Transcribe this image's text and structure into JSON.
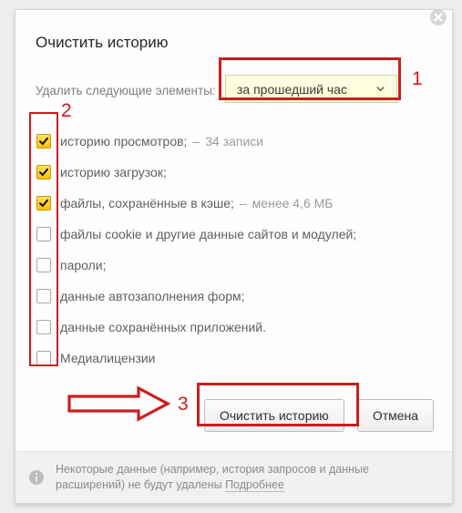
{
  "title": "Очистить историю",
  "time_range": {
    "label": "Удалить следующие элементы:",
    "selected": "за прошедший час"
  },
  "options": [
    {
      "label": "историю просмотров;",
      "checked": true,
      "hint": "34 записи"
    },
    {
      "label": "историю загрузок;",
      "checked": true
    },
    {
      "label": "файлы, сохранённые в кэше;",
      "checked": true,
      "hint": "менее 4,6 МБ"
    },
    {
      "label": "файлы cookie и другие данные сайтов и модулей;",
      "checked": false
    },
    {
      "label": "пароли;",
      "checked": false
    },
    {
      "label": "данные автозаполнения форм;",
      "checked": false
    },
    {
      "label": "данные сохранённых приложений.",
      "checked": false
    },
    {
      "label": "Медиалицензии",
      "checked": false
    }
  ],
  "buttons": {
    "clear": "Очистить историю",
    "cancel": "Отмена"
  },
  "footer": {
    "text": "Некоторые данные (например, история запросов и данные расширений) не будут удалены ",
    "link": "Подробнее"
  },
  "annotations": {
    "1": "1",
    "2": "2",
    "3": "3"
  }
}
